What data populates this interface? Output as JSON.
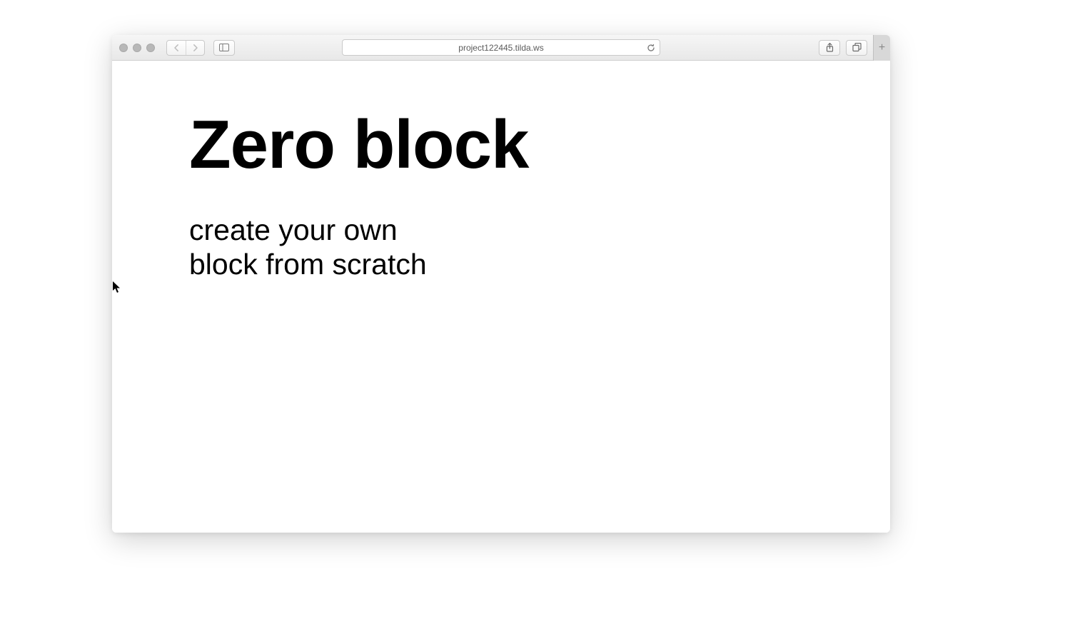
{
  "browser": {
    "url": "project122445.tilda.ws"
  },
  "page": {
    "title": "Zero block",
    "subtitle_line1": "create your own",
    "subtitle_line2": "block from scratch"
  }
}
